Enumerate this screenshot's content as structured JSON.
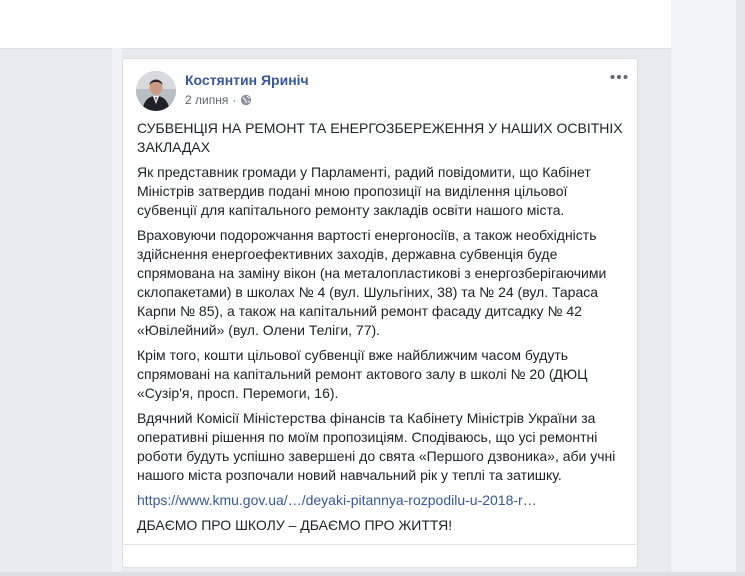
{
  "post": {
    "author": "Костянтин Яриніч",
    "date": "2 липня",
    "separator": "·",
    "privacy_icon": "globe-icon",
    "more_icon": "more-dots-icon",
    "paragraphs": [
      "СУБВЕНЦІЯ НА РЕМОНТ ТА ЕНЕРГОЗБЕРЕЖЕННЯ У НАШИХ ОСВІТНІХ ЗАКЛАДАХ",
      "Як представник громади у Парламенті, радий повідомити, що Кабінет Міністрів затвердив подані мною пропозиції на виділення цільової субвенції для капітального ремонту закладів освіти нашого міста.",
      "Враховуючи подорожчання вартості енергоносіїв, а також необхідність здійснення енергоефективних заходів, державна субвенція буде спрямована на заміну вікон (на металопластикові з енергозберігаючими склопакетами) в школах № 4 (вул. Шульгіних, 38) та № 24 (вул. Тараса Карпи № 85), а також на капітальний ремонт фасаду дитсадку № 42 «Ювілейний» (вул. Олени Теліги, 77).",
      "Крім того, кошти цільової субвенції вже найближчим часом будуть спрямовані на капітальний ремонт актового залу в школі № 20 (ДЮЦ «Сузір'я, просп. Перемоги, 16).",
      "Вдячний Комісії Міністерства фінансів та Кабінету Міністрів України за оперативні рішення по моїм пропозиціям. Сподіваюсь, що усі ремонтні роботи будуть успішно завершені до свята «Першого дзвоника», аби учні нашого міста розпочали новий навчальний рік у теплі та затишку."
    ],
    "link": "https://www.kmu.gov.ua/…/deyaki-pitannya-rozpodilu-u-2018-r…",
    "closing": "ДБАЄМО ПРО ШКОЛУ – ДБАЄМО ПРО ЖИТТЯ!"
  },
  "colors": {
    "link": "#365899",
    "text": "#1d2129",
    "meta": "#616770",
    "background": "#e9ebee"
  }
}
